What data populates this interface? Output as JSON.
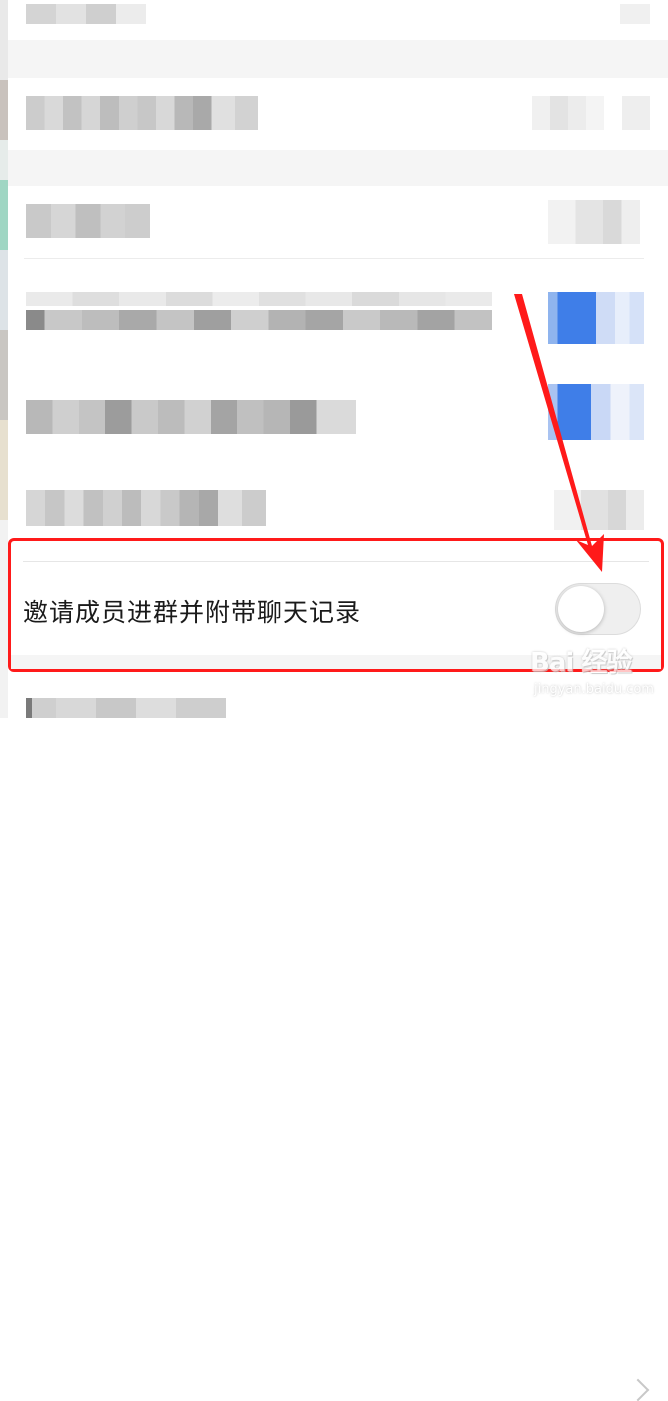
{
  "colors": {
    "annotation_red": "#ff1a1a",
    "toggle_off_track": "#efefef",
    "blurred_blue": "#3f7ee8"
  },
  "highlighted_setting": {
    "label": "邀请成员进群并附带聊天记录",
    "toggle_state": "off"
  },
  "annotation": {
    "shape": "arrow",
    "points_to": "toggle-switch"
  },
  "watermark": {
    "logo_text": "Bai 经验",
    "sub_text": "jingyan.baidu.com"
  },
  "icons": {
    "chevron": "chevron-right-icon",
    "arrow": "red-arrow-annotation"
  }
}
